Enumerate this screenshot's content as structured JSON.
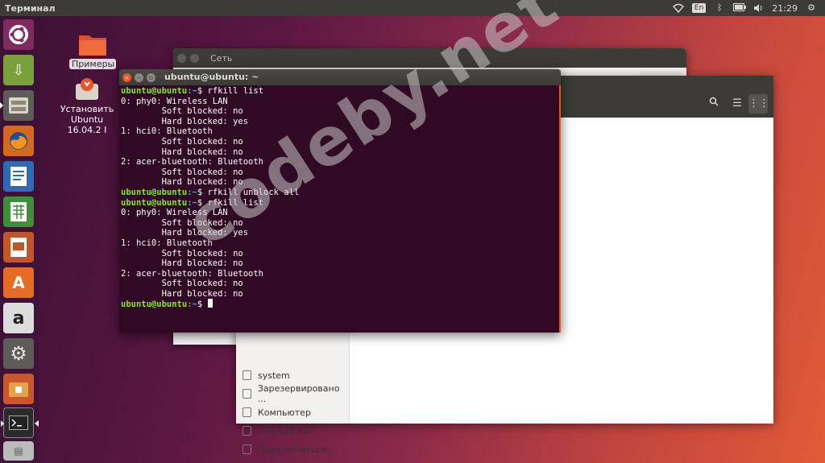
{
  "topbar": {
    "title": "Терминал",
    "lang": "En",
    "time": "21:29"
  },
  "desktop": [
    {
      "label": "Примеры"
    },
    {
      "label_line1": "Установить",
      "label_line2": "Ubuntu 16.04.2 I"
    }
  ],
  "back_window": {
    "title": "Сеть"
  },
  "files": {
    "sidebar": [
      "system",
      "Зарезервировано ...",
      "Компьютер",
      "Том 122 ГБ",
      "Подключиться..."
    ]
  },
  "terminal": {
    "title": "ubuntu@ubuntu: ~",
    "prompt_user": "ubuntu@ubuntu",
    "prompt_path": ":~",
    "prompt_sym": "$ ",
    "cmd1": "rfkill list",
    "cmd2": "rfkill unblock all",
    "cmd3": "rfkill list",
    "out1": [
      "0: phy0: Wireless LAN",
      "        Soft blocked: no",
      "        Hard blocked: yes",
      "1: hci0: Bluetooth",
      "        Soft blocked: no",
      "        Hard blocked: no",
      "2: acer-bluetooth: Bluetooth",
      "        Soft blocked: no",
      "        Hard blocked: no"
    ],
    "out2": [
      "0: phy0: Wireless LAN",
      "        Soft blocked: no",
      "        Hard blocked: yes",
      "1: hci0: Bluetooth",
      "        Soft blocked: no",
      "        Hard blocked: no",
      "2: acer-bluetooth: Bluetooth",
      "        Soft blocked: no",
      "        Hard blocked: no"
    ]
  },
  "watermark": "codeby.net",
  "colors": {
    "prompt": "#8ae234",
    "path": "#729fcf",
    "terminal_bg": "#300a24",
    "accent": "#e95420"
  }
}
